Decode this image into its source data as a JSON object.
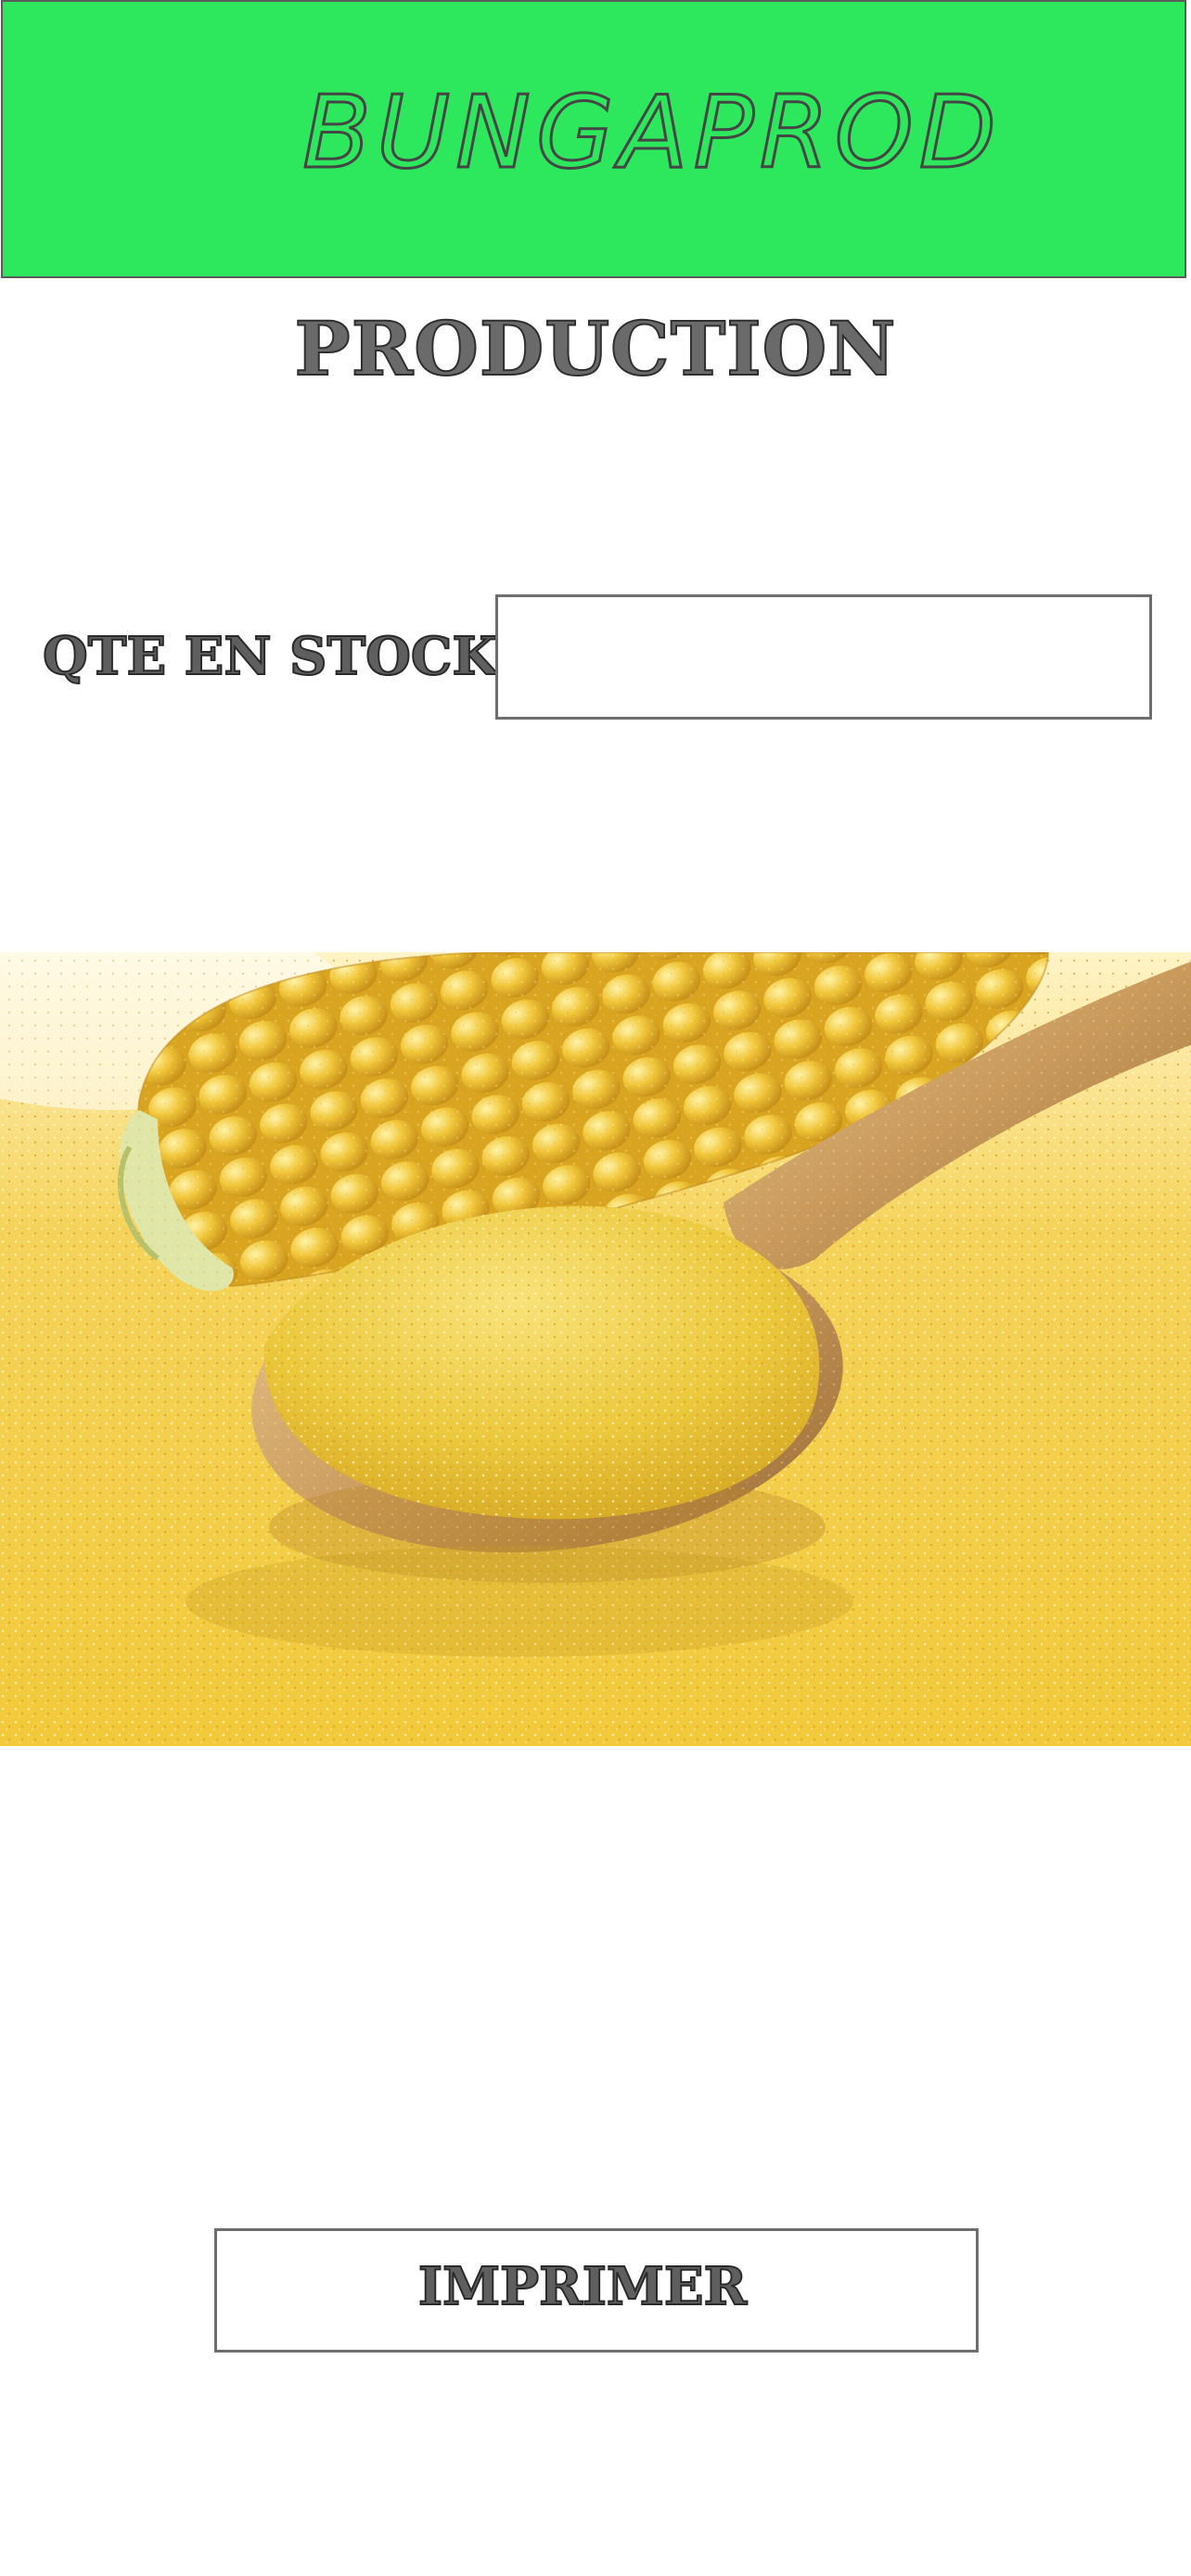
{
  "header": {
    "brand": "BUNGAPROD"
  },
  "page": {
    "title": "PRODUCTION"
  },
  "stock": {
    "label": "QTE EN STOCK",
    "value": "",
    "placeholder": ""
  },
  "image": {
    "icon": "corn-flour-photo"
  },
  "actions": {
    "print_label": "IMPRIMER"
  },
  "colors": {
    "header_bg": "#2de85c",
    "border": "#6e6e6e",
    "text_dark": "#2a2a2a"
  }
}
